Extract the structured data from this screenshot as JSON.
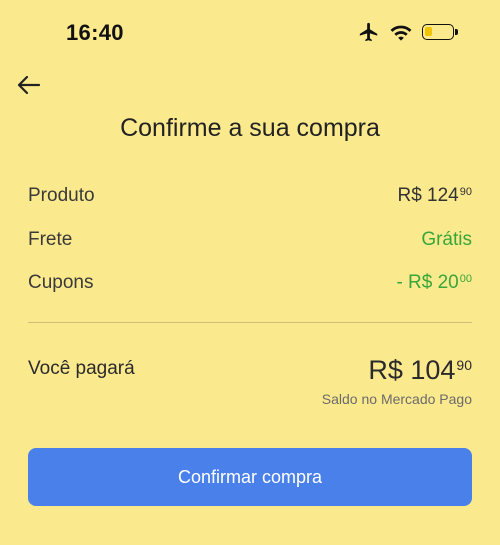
{
  "status_bar": {
    "time": "16:40",
    "icons": [
      "airplane-icon",
      "wifi-icon",
      "battery-icon"
    ],
    "battery_level": 0.25
  },
  "header": {
    "back_icon": "arrow-left-icon",
    "title": "Confirme a sua compra"
  },
  "summary": {
    "rows": [
      {
        "label": "Produto",
        "value_main": "R$ 124",
        "value_cents": "90",
        "color": "#333333"
      },
      {
        "label": "Frete",
        "value_main": "Grátis",
        "value_cents": "",
        "color": "#39a63a"
      },
      {
        "label": "Cupons",
        "value_main": "- R$ 20",
        "value_cents": "00",
        "color": "#39a63a"
      }
    ]
  },
  "total": {
    "label": "Você pagará",
    "value_main": "R$ 104",
    "value_cents": "90",
    "note": "Saldo no Mercado Pago"
  },
  "actions": {
    "confirm_label": "Confirmar compra",
    "confirm_color": "#4a80ea"
  },
  "colors": {
    "background": "#fbe98d",
    "accent_green": "#39a63a"
  }
}
